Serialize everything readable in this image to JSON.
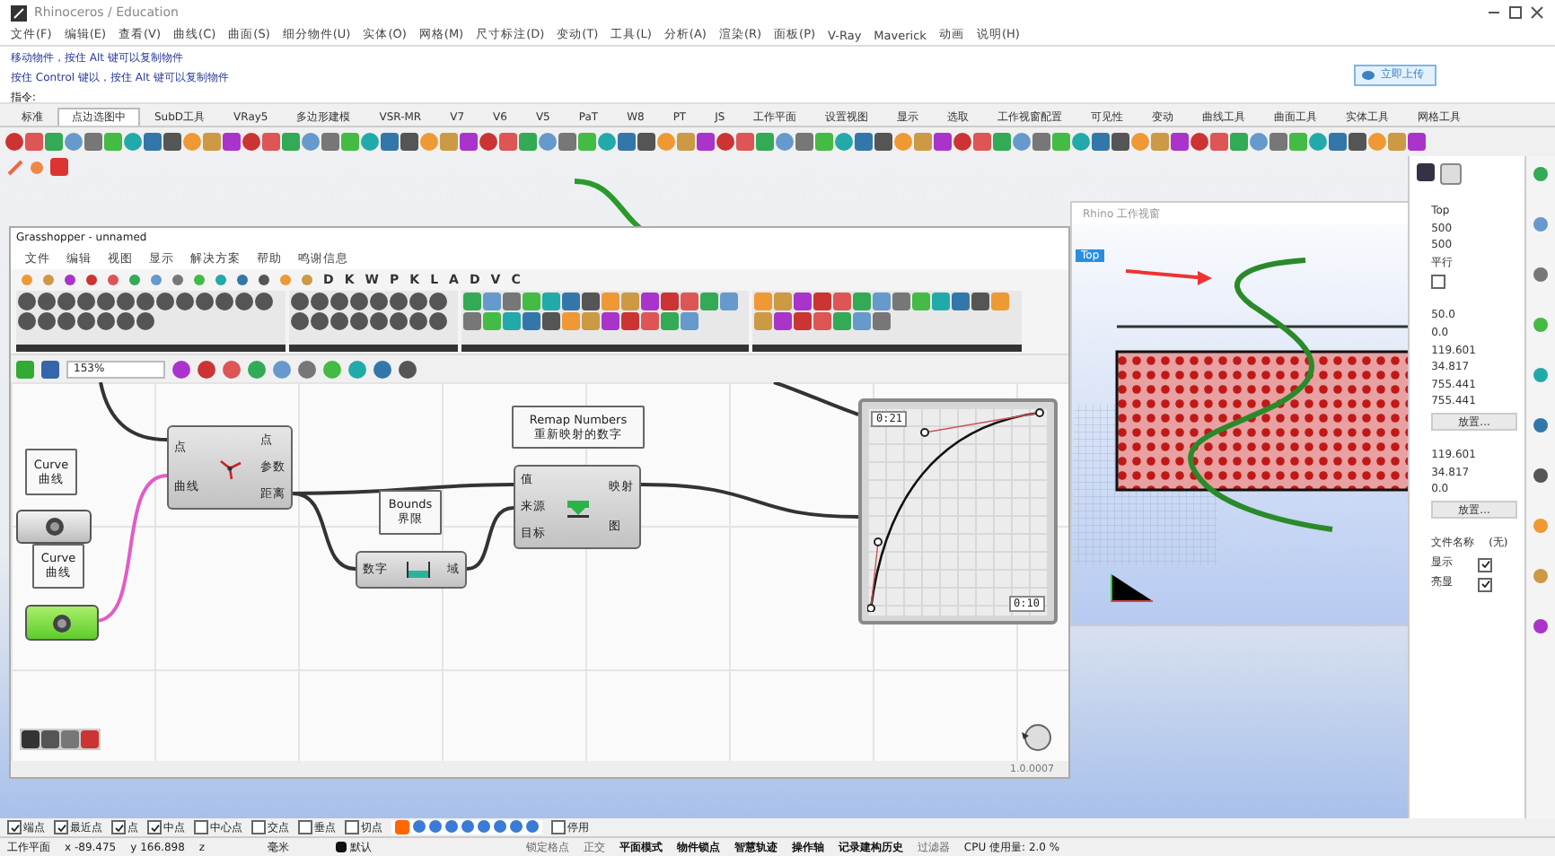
{
  "window": {
    "title": "Rhinoceros / Education"
  },
  "menu": [
    "文件(F)",
    "编辑(E)",
    "查看(V)",
    "曲线(C)",
    "曲面(S)",
    "细分物件(U)",
    "实体(O)",
    "网格(M)",
    "尺寸标注(D)",
    "变动(T)",
    "工具(L)",
    "分析(A)",
    "渲染(R)",
    "面板(P)",
    "V-Ray",
    "Maverick",
    "动画",
    "说明(H)"
  ],
  "command_history": [
    "移动物件，按住 Alt 键可以复制物件",
    "按住 Control 键以，按住 Alt 键可以复制物件"
  ],
  "command_prompt": "指令:",
  "upload_button": "立即上传",
  "toolbar_tabs": [
    {
      "label": "标准",
      "selected": false
    },
    {
      "label": "点边选图中",
      "selected": true
    },
    {
      "label": "SubD工具",
      "selected": false
    },
    {
      "label": "VRay5",
      "selected": false
    },
    {
      "label": "多边形建模",
      "selected": false
    },
    {
      "label": "VSR-MR",
      "selected": false
    },
    {
      "label": "V7",
      "selected": false
    },
    {
      "label": "V6",
      "selected": false
    },
    {
      "label": "V5",
      "selected": false
    },
    {
      "label": "PaT",
      "selected": false
    },
    {
      "label": "W8",
      "selected": false
    },
    {
      "label": "PT",
      "selected": false
    },
    {
      "label": "JS",
      "selected": false
    },
    {
      "label": "工作平面",
      "selected": false
    },
    {
      "label": "设置视图",
      "selected": false
    },
    {
      "label": "显示",
      "selected": false
    },
    {
      "label": "选取",
      "selected": false
    },
    {
      "label": "工作视窗配置",
      "selected": false
    },
    {
      "label": "可见性",
      "selected": false
    },
    {
      "label": "变动",
      "selected": false
    },
    {
      "label": "曲线工具",
      "selected": false
    },
    {
      "label": "曲面工具",
      "selected": false
    },
    {
      "label": "实体工具",
      "selected": false
    },
    {
      "label": "网格工具",
      "selected": false
    }
  ],
  "grasshopper": {
    "title": "Grasshopper - unnamed",
    "menu": [
      "文件",
      "编辑",
      "视图",
      "显示",
      "解决方案",
      "帮助",
      "鸣谢信息"
    ],
    "tab_letters": [
      "D",
      "K",
      "W",
      "P",
      "K",
      "L",
      "A",
      "D",
      "V",
      "C"
    ],
    "zoom": "153%",
    "tooltips": [
      {
        "title": "Curve",
        "subtitle": "曲线"
      },
      {
        "title": "Curve",
        "subtitle": "曲线"
      },
      {
        "title": "Bounds",
        "subtitle": "界限"
      },
      {
        "title": "Remap Numbers",
        "subtitle": "重新映射的数字"
      }
    ],
    "params": [
      {
        "selected": false
      },
      {
        "selected": true
      }
    ],
    "components": [
      {
        "kind": "closest",
        "inputs": [
          "点",
          "曲线"
        ],
        "outputs": [
          "点",
          "参数",
          "距离"
        ]
      },
      {
        "kind": "bounds",
        "inputs": [
          "数字"
        ],
        "outputs": [
          "域"
        ]
      },
      {
        "kind": "remap",
        "inputs": [
          "值",
          "来源",
          "目标"
        ],
        "outputs": [
          "映射",
          "图"
        ]
      }
    ],
    "graph_mapper": {
      "labels": [
        "0:21",
        "0:10"
      ]
    },
    "version": "1.0.0007"
  },
  "viewport": {
    "title": "Rhino 工作视窗",
    "view_label": "Top"
  },
  "properties": [
    {
      "kind": "text",
      "value": "Top"
    },
    {
      "kind": "text",
      "value": "500"
    },
    {
      "kind": "text",
      "value": "500"
    },
    {
      "kind": "text",
      "value": "平行"
    },
    {
      "kind": "checkbox",
      "checked": false
    },
    {
      "kind": "gap"
    },
    {
      "kind": "text",
      "value": "50.0"
    },
    {
      "kind": "text",
      "value": "0.0"
    },
    {
      "kind": "text",
      "value": "119.601"
    },
    {
      "kind": "text",
      "value": "34.817"
    },
    {
      "kind": "text",
      "value": "755.441"
    },
    {
      "kind": "text",
      "value": "755.441"
    },
    {
      "kind": "button",
      "value": "放置..."
    },
    {
      "kind": "gap"
    },
    {
      "kind": "text",
      "value": "119.601"
    },
    {
      "kind": "text",
      "value": "34.817"
    },
    {
      "kind": "text",
      "value": "0.0"
    },
    {
      "kind": "button",
      "value": "放置..."
    },
    {
      "kind": "gap"
    },
    {
      "kind": "row",
      "label": "文件名称",
      "value": "(无)"
    },
    {
      "kind": "check_row",
      "label": "显示",
      "checked": true
    },
    {
      "kind": "check_row",
      "label": "亮显",
      "checked": true
    }
  ],
  "osnaps": [
    {
      "label": "端点",
      "checked": true
    },
    {
      "label": "最近点",
      "checked": true
    },
    {
      "label": "点",
      "checked": true
    },
    {
      "label": "中点",
      "checked": true
    },
    {
      "label": "中心点",
      "checked": false
    },
    {
      "label": "交点",
      "checked": false
    },
    {
      "label": "垂点",
      "checked": false
    },
    {
      "label": "切点",
      "checked": false
    }
  ],
  "osnap_disable": {
    "label": "停用",
    "checked": false
  },
  "status_bar": {
    "plane": "工作平面",
    "x": "x -89.475",
    "y": "y 166.898",
    "z": "z",
    "units": "毫米",
    "layer": "默认",
    "toggles": [
      {
        "label": "锁定格点",
        "on": false
      },
      {
        "label": "正交",
        "on": false
      },
      {
        "label": "平面模式",
        "on": true
      },
      {
        "label": "物件锁点",
        "on": true
      },
      {
        "label": "智慧轨迹",
        "on": true
      },
      {
        "label": "操作轴",
        "on": true
      },
      {
        "label": "记录建构历史",
        "on": true
      },
      {
        "label": "过滤器",
        "on": false
      }
    ],
    "cpu": "CPU 使用量: 2.0 %"
  }
}
